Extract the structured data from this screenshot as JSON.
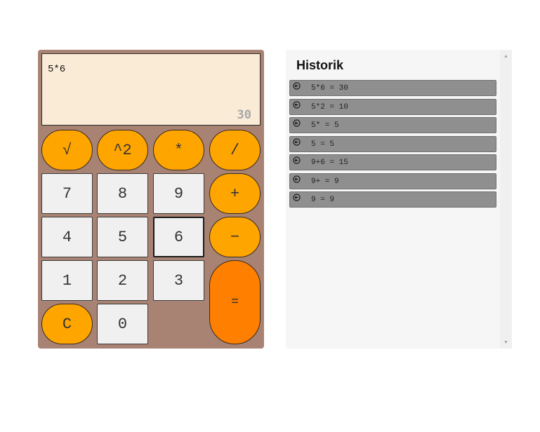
{
  "calculator": {
    "expression": "5*6",
    "result": "30",
    "buttons": {
      "sqrt": "√",
      "square": "^2",
      "multiply": "*",
      "divide": "/",
      "seven": "7",
      "eight": "8",
      "nine": "9",
      "plus": "+",
      "four": "4",
      "five": "5",
      "six": "6",
      "minus": "−",
      "one": "1",
      "two": "2",
      "three": "3",
      "equals": "=",
      "clear": "C",
      "zero": "0"
    },
    "colors": {
      "body": "#a88374",
      "display": "#faebd7",
      "operator": "#ffa500",
      "equals": "#ff7f00",
      "number": "#f0f0f0"
    }
  },
  "history": {
    "title": "Historik",
    "item_icon": "arrow-left-circle-icon",
    "items": [
      {
        "text": "5*6 = 30"
      },
      {
        "text": "5*2 = 10"
      },
      {
        "text": "5* = 5"
      },
      {
        "text": "5 = 5"
      },
      {
        "text": "9+6 = 15"
      },
      {
        "text": "9+ = 9"
      },
      {
        "text": "9 = 9"
      }
    ]
  }
}
